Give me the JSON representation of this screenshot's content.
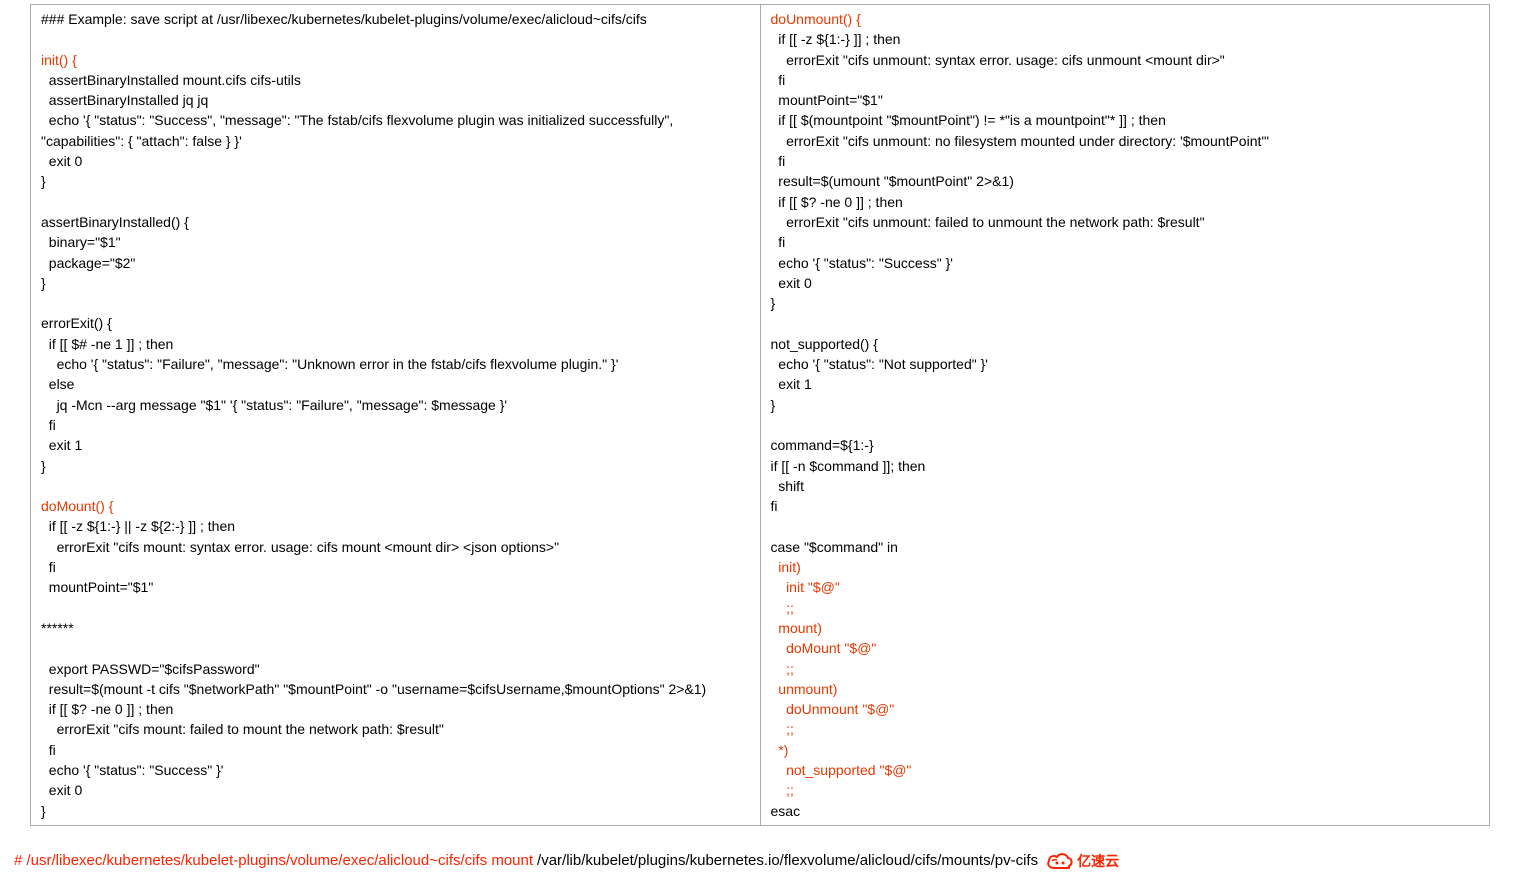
{
  "left": {
    "l1": "### Example: save script at /usr/libexec/kubernetes/kubelet-plugins/volume/exec/alicloud~cifs/cifs",
    "l2": "",
    "l3": "init() {",
    "l4": "  assertBinaryInstalled mount.cifs cifs-utils",
    "l5": "  assertBinaryInstalled jq jq",
    "l6": "  echo '{ \"status\": \"Success\", \"message\": \"The fstab/cifs flexvolume plugin was initialized successfully\", \"capabilities\": { \"attach\": false } }'",
    "l7": "  exit 0",
    "l8": "}",
    "l9": "",
    "l10": "assertBinaryInstalled() {",
    "l11": "  binary=\"$1\"",
    "l12": "  package=\"$2\"",
    "l13": "}",
    "l14": "",
    "l15": "errorExit() {",
    "l16": "  if [[ $# -ne 1 ]] ; then",
    "l17": "    echo '{ \"status\": \"Failure\", \"message\": \"Unknown error in the fstab/cifs flexvolume plugin.\" }'",
    "l18": "  else",
    "l19": "    jq -Mcn --arg message \"$1\" '{ \"status\": \"Failure\", \"message\": $message }'",
    "l20": "  fi",
    "l21": "  exit 1",
    "l22": "}",
    "l23": "",
    "l24": "doMount() {",
    "l25": "  if [[ -z ${1:-} || -z ${2:-} ]] ; then",
    "l26": "    errorExit \"cifs mount: syntax error. usage: cifs mount <mount dir> <json options>\"",
    "l27": "  fi",
    "l28": "  mountPoint=\"$1\"",
    "l29": "",
    "l30": "******",
    "l31": "",
    "l32": "  export PASSWD=\"$cifsPassword\"",
    "l33": "  result=$(mount -t cifs \"$networkPath\" \"$mountPoint\" -o \"username=$cifsUsername,$mountOptions\" 2>&1)",
    "l34": "  if [[ $? -ne 0 ]] ; then",
    "l35": "    errorExit \"cifs mount: failed to mount the network path: $result\"",
    "l36": "  fi",
    "l37": "  echo '{ \"status\": \"Success\" }'",
    "l38": "  exit 0",
    "l39": "}"
  },
  "right": {
    "r1": "doUnmount() {",
    "r2": "  if [[ -z ${1:-} ]] ; then",
    "r3": "    errorExit \"cifs unmount: syntax error. usage: cifs unmount <mount dir>\"",
    "r4": "  fi",
    "r5": "  mountPoint=\"$1\"",
    "r6": "  if [[ $(mountpoint \"$mountPoint\") != *\"is a mountpoint\"* ]] ; then",
    "r7": "    errorExit \"cifs unmount: no filesystem mounted under directory: '$mountPoint'\"",
    "r8": "  fi",
    "r9": "  result=$(umount \"$mountPoint\" 2>&1)",
    "r10": "  if [[ $? -ne 0 ]] ; then",
    "r11": "    errorExit \"cifs unmount: failed to unmount the network path: $result\"",
    "r12": "  fi",
    "r13": "  echo '{ \"status\": \"Success\" }'",
    "r14": "  exit 0",
    "r15": "}",
    "r16": "",
    "r17": "not_supported() {",
    "r18": "  echo '{ \"status\": \"Not supported\" }'",
    "r19": "  exit 1",
    "r20": "}",
    "r21": "",
    "r22": "command=${1:-}",
    "r23": "if [[ -n $command ]]; then",
    "r24": "  shift",
    "r25": "fi",
    "r26": "",
    "r27": "case \"$command\" in",
    "r28": "  init)",
    "r29": "    init \"$@\"",
    "r30": "    ;;",
    "r31": "  mount)",
    "r32": "    doMount \"$@\"",
    "r33": "    ;;",
    "r34": "  unmount)",
    "r35": "    doUnmount \"$@\"",
    "r36": "    ;;",
    "r37": "  *)",
    "r38": "    not_supported \"$@\"",
    "r39": "    ;;",
    "r40": "esac"
  },
  "footer": {
    "red_part": "# /usr/libexec/kubernetes/kubelet-plugins/volume/exec/alicloud~cifs/cifs mount ",
    "black_part": "/var/lib/kubelet/plugins/kubernetes.io/flexvolume/alicloud/cifs/mounts/pv-cifs",
    "logo_text": "亿速云"
  }
}
